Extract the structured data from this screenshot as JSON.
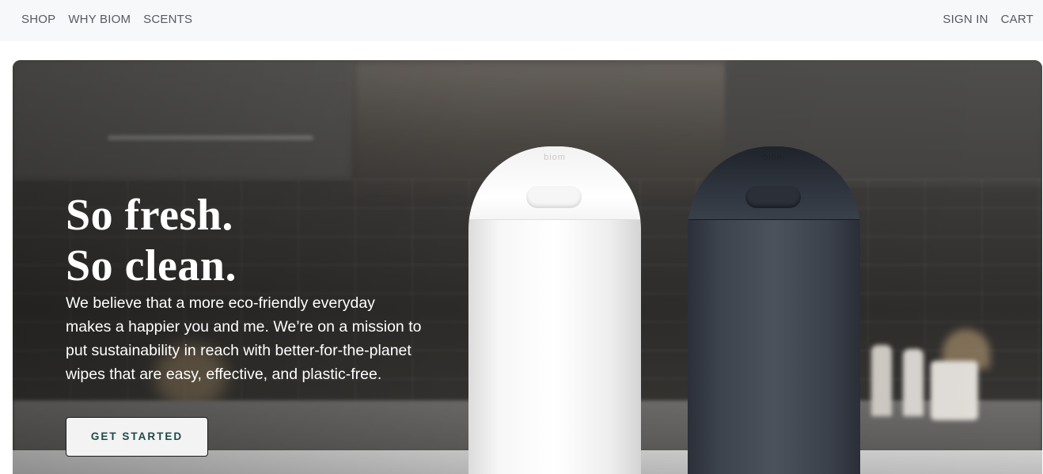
{
  "nav": {
    "left": [
      {
        "label": "SHOP"
      },
      {
        "label": "WHY BIOM"
      },
      {
        "label": "SCENTS"
      }
    ],
    "right": [
      {
        "label": "SIGN IN"
      },
      {
        "label": "CART"
      }
    ]
  },
  "hero": {
    "title_line1": "So fresh.",
    "title_line2": "So clean.",
    "description": "We believe that a more eco-friendly everyday makes a happier you and me. We’re on a mission to put sustainability in reach with better-for-the-planet wipes that are easy, effective, and plastic-free.",
    "cta_label": "GET STARTED",
    "product_logo": "biom"
  },
  "colors": {
    "nav_bg": "#f7f8fa",
    "nav_text": "#555a60",
    "cta_text": "#1d4a49",
    "cta_bg": "#f3f3f3"
  }
}
